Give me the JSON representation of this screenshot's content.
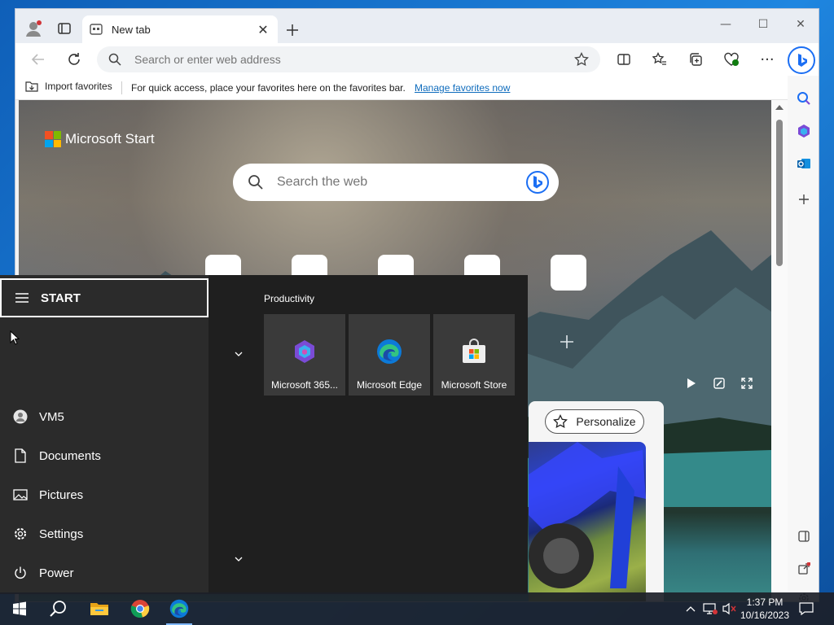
{
  "browser": {
    "tab_title": "New tab",
    "address_placeholder": "Search or enter web address",
    "favorites_bar": {
      "import": "Import favorites",
      "message": "For quick access, place your favorites here on the favorites bar.",
      "manage_link": "Manage favorites now"
    }
  },
  "newtab": {
    "brand": "Microsoft Start",
    "search_placeholder": "Search the web",
    "personalize": "Personalize"
  },
  "start_menu": {
    "title": "START",
    "section_label": "Productivity",
    "items": [
      {
        "label": "VM5",
        "icon": "user-icon"
      },
      {
        "label": "Documents",
        "icon": "document-icon"
      },
      {
        "label": "Pictures",
        "icon": "pictures-icon"
      },
      {
        "label": "Settings",
        "icon": "gear-icon"
      },
      {
        "label": "Power",
        "icon": "power-icon"
      }
    ],
    "tiles": [
      {
        "label": "Microsoft 365...",
        "icon": "m365-icon"
      },
      {
        "label": "Microsoft Edge",
        "icon": "edge-icon"
      },
      {
        "label": "Microsoft Store",
        "icon": "store-icon"
      }
    ]
  },
  "taskbar": {
    "time": "1:37 PM",
    "date": "10/16/2023"
  },
  "colors": {
    "edge_accent": "#1b6ef3",
    "start_bg": "#1f1f1f",
    "start_left_bg": "#2b2b2b",
    "link": "#0f6cbd"
  }
}
